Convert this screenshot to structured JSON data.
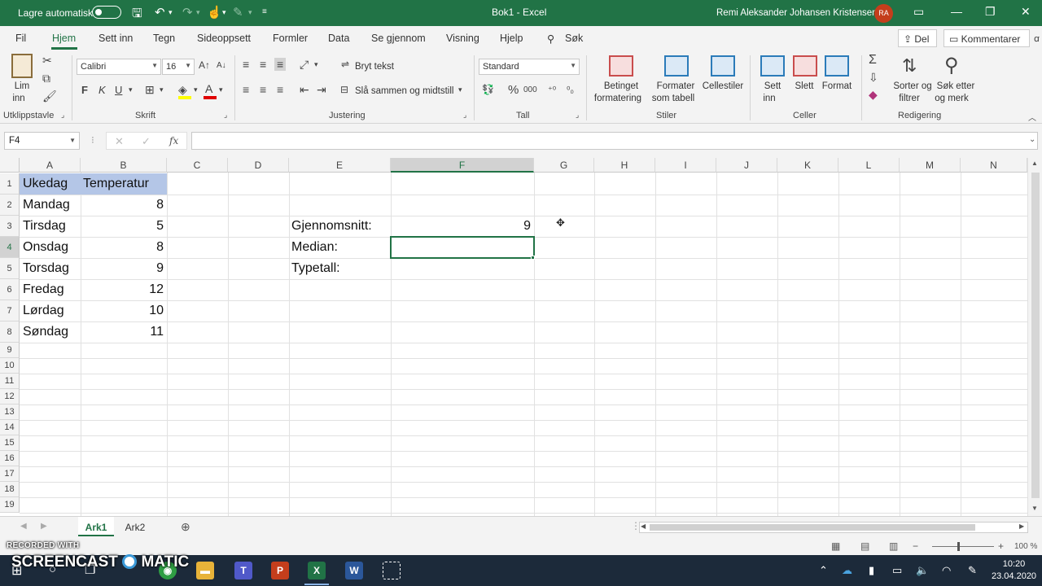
{
  "titlebar": {
    "autosave_label": "Lagre automatisk",
    "document_title": "Bok1  -  Excel",
    "user_name": "Remi Aleksander Johansen Kristensen",
    "user_initials": "RA"
  },
  "menu": {
    "tabs": [
      "Fil",
      "Hjem",
      "Sett inn",
      "Tegn",
      "Sideoppsett",
      "Formler",
      "Data",
      "Se gjennom",
      "Visning",
      "Hjelp"
    ],
    "active_tab": "Hjem",
    "search_label": "Søk",
    "share_label": "Del",
    "comments_label": "Kommentarer"
  },
  "ribbon": {
    "clipboard": {
      "paste_label_1": "Lim",
      "paste_label_2": "inn",
      "group": "Utklippstavle"
    },
    "font": {
      "name": "Calibri",
      "size": "16",
      "bold": "F",
      "italic": "K",
      "underline": "U",
      "group": "Skrift"
    },
    "alignment": {
      "wrap_text": "Bryt tekst",
      "merge_center": "Slå sammen og midtstill",
      "group": "Justering"
    },
    "number": {
      "format": "Standard",
      "percent": "%",
      "thousands": "000",
      "group": "Tall"
    },
    "styles": {
      "conditional_1": "Betinget",
      "conditional_2": "formatering",
      "table_1": "Formater",
      "table_2": "som tabell",
      "cell_styles": "Cellestiler",
      "group": "Stiler"
    },
    "cells": {
      "insert_1": "Sett",
      "insert_2": "inn",
      "delete": "Slett",
      "format": "Format",
      "group": "Celler"
    },
    "editing": {
      "sort_1": "Sorter og",
      "sort_2": "filtrer",
      "find_1": "Søk etter",
      "find_2": "og merk",
      "group": "Redigering"
    }
  },
  "formula_bar": {
    "name_box": "F4",
    "fx_label": "fx",
    "cancel_label": "✕",
    "enter_label": "✓",
    "formula": ""
  },
  "sheet": {
    "columns": [
      "A",
      "B",
      "C",
      "D",
      "E",
      "F",
      "G",
      "H",
      "I",
      "J",
      "K",
      "L",
      "M",
      "N"
    ],
    "rows": [
      "1",
      "2",
      "3",
      "4",
      "5",
      "6",
      "7",
      "8",
      "9",
      "10",
      "11",
      "12",
      "13",
      "14",
      "15",
      "16",
      "17",
      "18",
      "19"
    ],
    "selected_cell": "F4",
    "header_day": "Ukedag",
    "header_temp": "Temperatur",
    "days": [
      "Mandag",
      "Tirsdag",
      "Onsdag",
      "Torsdag",
      "Fredag",
      "Lørdag",
      "Søndag"
    ],
    "temps": [
      "8",
      "5",
      "8",
      "9",
      "12",
      "10",
      "11"
    ],
    "stat_labels": [
      "Gjennomsnitt:",
      "Median:",
      "Typetall:"
    ],
    "average_value": "9"
  },
  "sheet_tabs": {
    "tabs": [
      "Ark1",
      "Ark2"
    ],
    "active": "Ark1"
  },
  "statusbar": {
    "zoom": "100 %"
  },
  "watermark": {
    "line1": "RECORDED WITH",
    "line2": "SCREENCAST",
    "line3": "MATIC"
  },
  "taskbar": {
    "time": "10:20",
    "date": "23.04.2020"
  }
}
